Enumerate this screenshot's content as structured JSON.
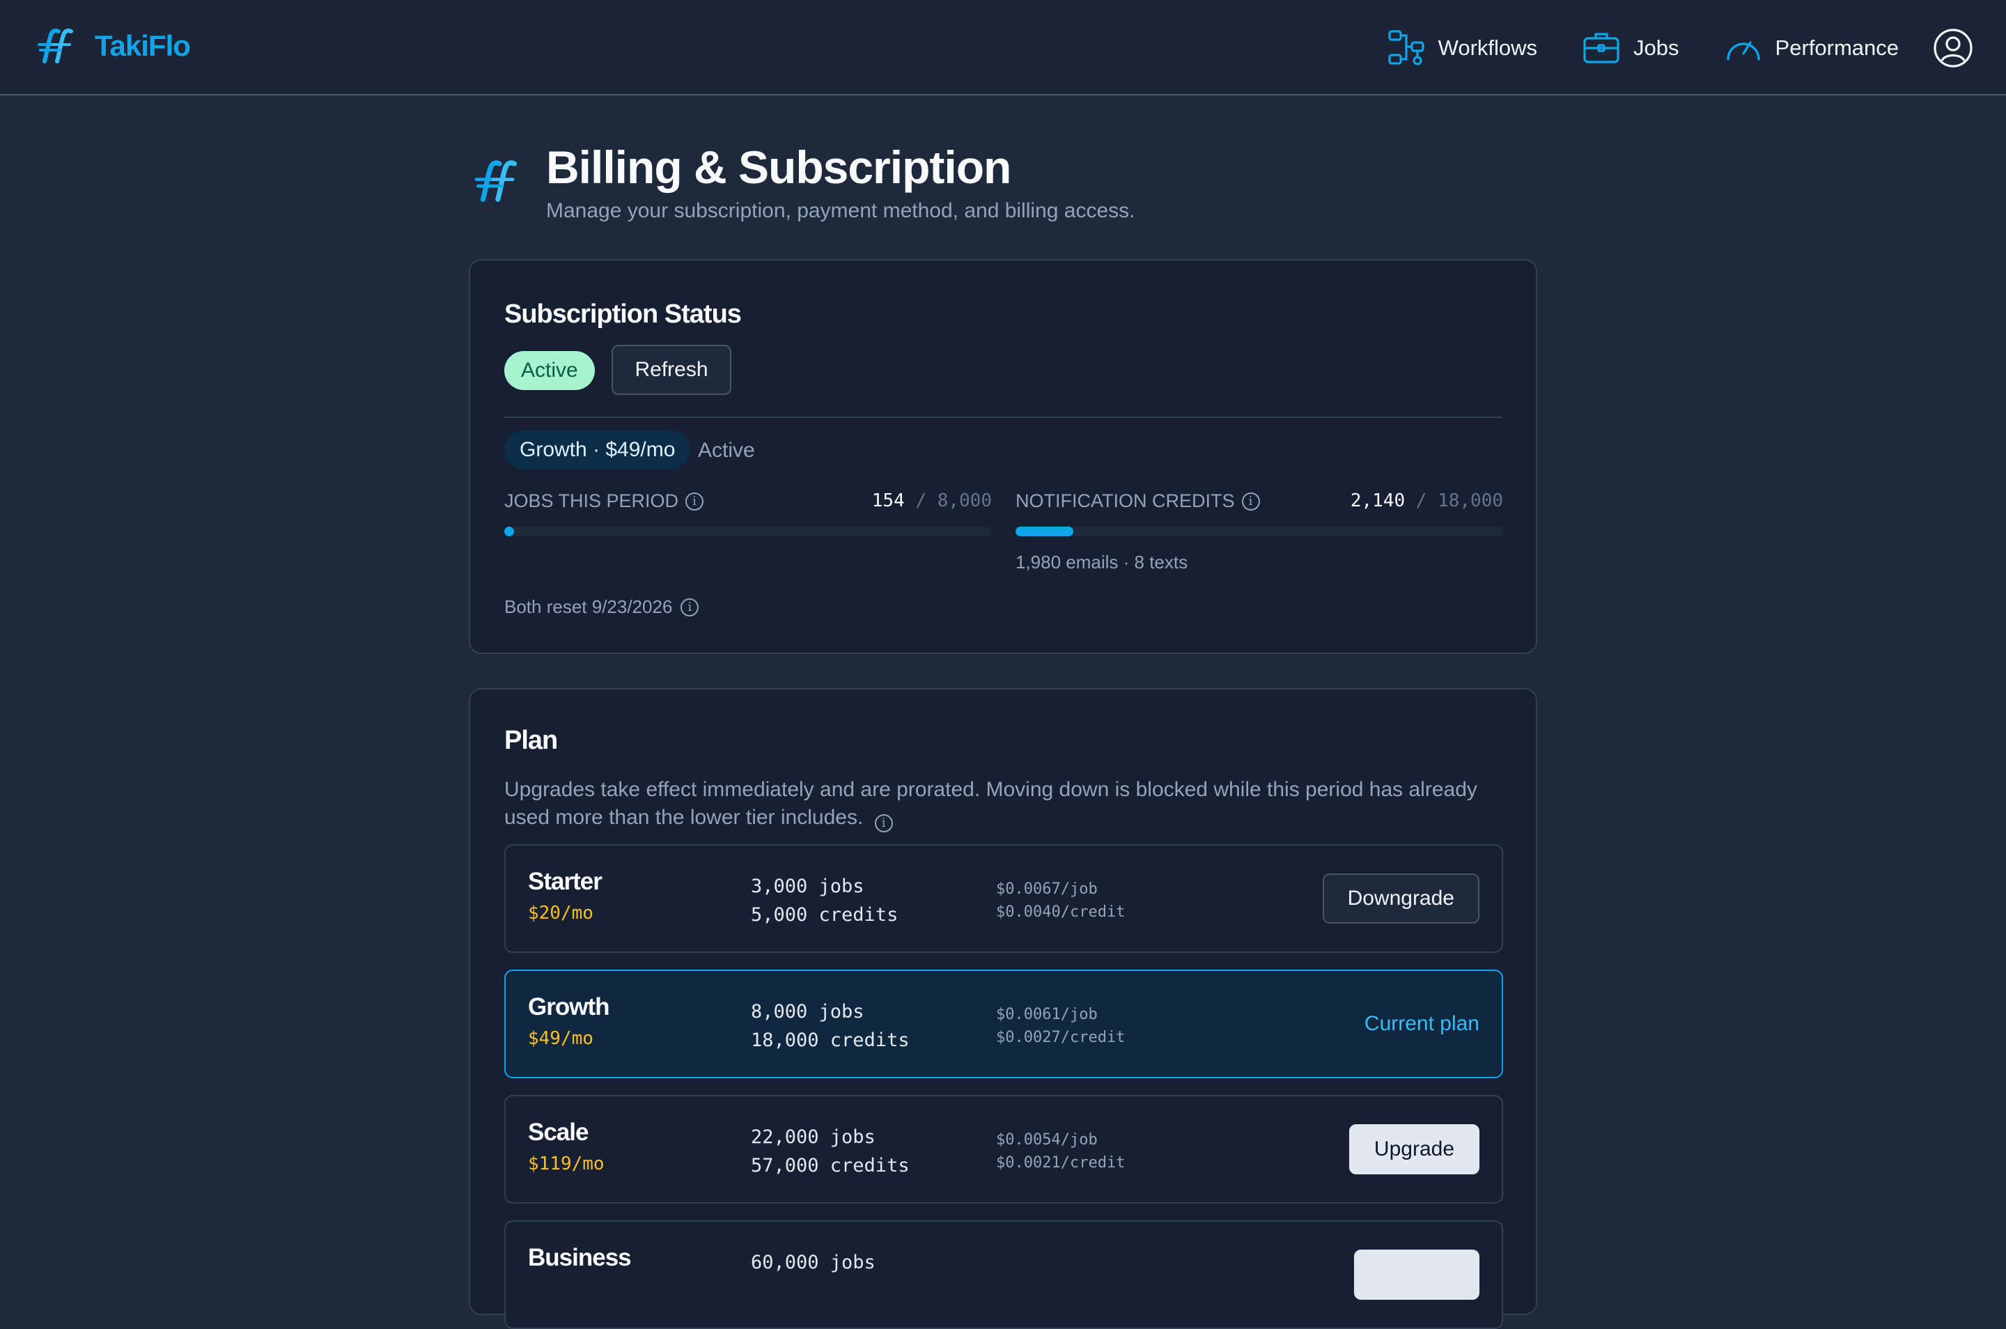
{
  "nav": {
    "brand": "TakiFlo",
    "links": [
      {
        "label": "Workflows",
        "icon": "workflow-icon"
      },
      {
        "label": "Jobs",
        "icon": "briefcase-icon"
      },
      {
        "label": "Performance",
        "icon": "gauge-icon"
      }
    ],
    "account_icon": "user-circle-icon"
  },
  "header": {
    "title": "Billing & Subscription",
    "subtitle": "Manage your subscription, payment method, and billing access."
  },
  "subscription": {
    "title": "Subscription Status",
    "status_badge": "Active",
    "refresh_label": "Refresh",
    "plan_pill": "Growth · $49/mo",
    "plan_status": "Active",
    "jobs": {
      "label": "JOBS THIS PERIOD",
      "used": "154",
      "sep": "/",
      "total": "8,000",
      "fraction": 0.019
    },
    "credits": {
      "label": "NOTIFICATION CREDITS",
      "used": "2,140",
      "sep": "/",
      "total": "18,000",
      "fraction": 0.119,
      "breakdown": "1,980 emails · 8 texts"
    },
    "reset": "Both reset 9/23/2026"
  },
  "plan": {
    "title": "Plan",
    "description": "Upgrades take effect immediately and are prorated. Moving down is blocked while this period has already used more than the lower tier includes.",
    "tiers": [
      {
        "name": "Starter",
        "price": "$20/mo",
        "jobs": "3,000 jobs",
        "credits": "5,000 credits",
        "job_rate": "$0.0067/job",
        "credit_rate": "$0.0040/credit",
        "action": "Downgrade"
      },
      {
        "name": "Growth",
        "price": "$49/mo",
        "jobs": "8,000 jobs",
        "credits": "18,000 credits",
        "job_rate": "$0.0061/job",
        "credit_rate": "$0.0027/credit",
        "action": "Current plan"
      },
      {
        "name": "Scale",
        "price": "$119/mo",
        "jobs": "22,000 jobs",
        "credits": "57,000 credits",
        "job_rate": "$0.0054/job",
        "credit_rate": "$0.0021/credit",
        "action": "Upgrade"
      },
      {
        "name": "Business",
        "price": "",
        "jobs": "60,000 jobs",
        "credits": "",
        "job_rate": "",
        "credit_rate": "",
        "action": ""
      }
    ]
  },
  "colors": {
    "accent": "#0ea5e9",
    "background": "#1e293b",
    "card": "#172033",
    "price": "#fbbf24",
    "success_badge": "#a7f3d0"
  }
}
